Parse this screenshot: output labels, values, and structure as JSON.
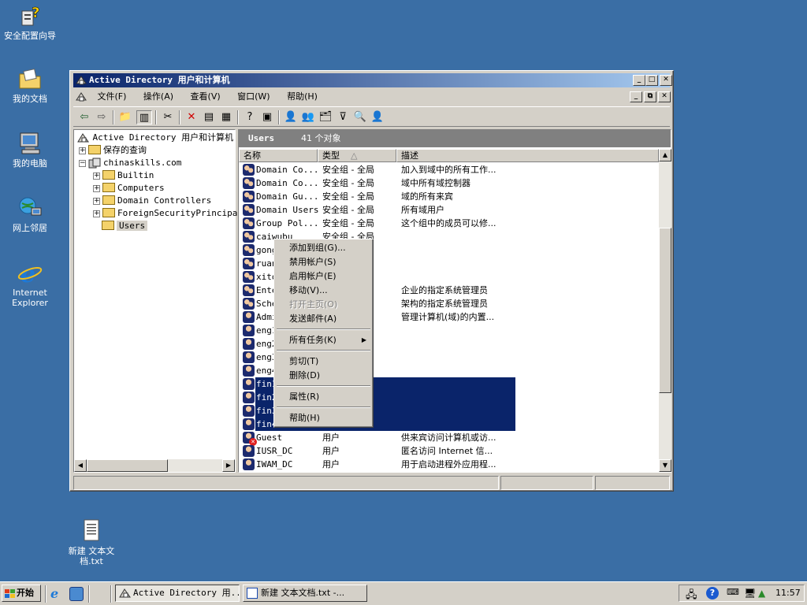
{
  "desktop": {
    "icons": [
      {
        "label": "安全配置向导",
        "icon": "security-wizard-icon"
      },
      {
        "label": "我的文档",
        "icon": "my-documents-icon"
      },
      {
        "label": "我的电脑",
        "icon": "my-computer-icon"
      },
      {
        "label": "网上邻居",
        "icon": "network-places-icon"
      },
      {
        "label": "Internet Explorer",
        "icon": "internet-explorer-icon"
      },
      {
        "label": "新建 文本文档.txt",
        "icon": "text-file-icon"
      }
    ]
  },
  "window": {
    "title": "Active Directory 用户和计算机",
    "menu": [
      "文件(F)",
      "操作(A)",
      "查看(V)",
      "窗口(W)",
      "帮助(H)"
    ],
    "tree": {
      "root": "Active Directory 用户和计算机",
      "saved_queries": "保存的查询",
      "domain": "chinaskills.com",
      "children": [
        "Builtin",
        "Computers",
        "Domain Controllers",
        "ForeignSecurityPrincipa",
        "Users"
      ]
    },
    "panel_title": "Users",
    "panel_count": "41 个对象",
    "columns": [
      "名称",
      "类型",
      "描述"
    ],
    "rows": [
      {
        "name": "Domain Co...",
        "type": "安全组 - 全局",
        "desc": "加入到域中的所有工作...",
        "icon": "group"
      },
      {
        "name": "Domain Co...",
        "type": "安全组 - 全局",
        "desc": "域中所有域控制器",
        "icon": "group"
      },
      {
        "name": "Domain Gu...",
        "type": "安全组 - 全局",
        "desc": "域的所有来宾",
        "icon": "group"
      },
      {
        "name": "Domain Users",
        "type": "安全组 - 全局",
        "desc": "所有域用户",
        "icon": "group"
      },
      {
        "name": "Group Pol...",
        "type": "安全组 - 全局",
        "desc": "这个组中的成员可以修...",
        "icon": "group"
      },
      {
        "name": "caiwubu",
        "type": "安全组 - 全局",
        "desc": "",
        "icon": "group"
      },
      {
        "name": "gong",
        "type": "局",
        "desc": "",
        "icon": "group"
      },
      {
        "name": "ruan",
        "type": "局",
        "desc": "",
        "icon": "group"
      },
      {
        "name": "xito",
        "type": "局",
        "desc": "",
        "icon": "group"
      },
      {
        "name": "Ente",
        "type": "用",
        "desc": "企业的指定系统管理员",
        "icon": "group"
      },
      {
        "name": "Sche",
        "type": "用",
        "desc": "架构的指定系统管理员",
        "icon": "group"
      },
      {
        "name": "Admi",
        "type": "",
        "desc": "管理计算机(域)的内置...",
        "icon": "user"
      },
      {
        "name": "eng1",
        "type": "",
        "desc": "",
        "icon": "user"
      },
      {
        "name": "eng2",
        "type": "",
        "desc": "",
        "icon": "user"
      },
      {
        "name": "eng3",
        "type": "",
        "desc": "",
        "icon": "user"
      },
      {
        "name": "eng4",
        "type": "",
        "desc": "",
        "icon": "user"
      },
      {
        "name": "fin1",
        "type": "",
        "desc": "",
        "icon": "user",
        "selected": true
      },
      {
        "name": "fin2",
        "type": "",
        "desc": "",
        "icon": "user",
        "selected": true
      },
      {
        "name": "fin3",
        "type": "",
        "desc": "",
        "icon": "user",
        "selected": true
      },
      {
        "name": "fin4",
        "type": "",
        "desc": "",
        "icon": "user",
        "selected": true
      },
      {
        "name": "Guest",
        "type": "用户",
        "desc": "供来宾访问计算机或访...",
        "icon": "user-disabled"
      },
      {
        "name": "IUSR_DC",
        "type": "用户",
        "desc": "匿名访问 Internet 信...",
        "icon": "user"
      },
      {
        "name": "IWAM_DC",
        "type": "用户",
        "desc": "用于启动进程外应用程...",
        "icon": "user"
      }
    ]
  },
  "context_menu": {
    "items": [
      {
        "label": "添加到组(G)...",
        "disabled": false
      },
      {
        "label": "禁用帐户(S)",
        "disabled": false
      },
      {
        "label": "启用帐户(E)",
        "disabled": false
      },
      {
        "label": "移动(V)...",
        "disabled": false
      },
      {
        "label": "打开主页(O)",
        "disabled": true
      },
      {
        "label": "发送邮件(A)",
        "disabled": false
      },
      {
        "label": "所有任务(K)",
        "disabled": false,
        "submenu": true
      },
      {
        "label": "剪切(T)",
        "disabled": false
      },
      {
        "label": "删除(D)",
        "disabled": false
      },
      {
        "label": "属性(R)",
        "disabled": false
      },
      {
        "label": "帮助(H)",
        "disabled": false
      }
    ]
  },
  "taskbar": {
    "start": "开始",
    "tasks": [
      "Active Directory 用...",
      "新建 文本文档.txt -..."
    ],
    "clock": "11:57"
  },
  "colors": {
    "desktop": "#3a6ea5",
    "title_active": "#0a246a",
    "selection": "#0a246a"
  }
}
